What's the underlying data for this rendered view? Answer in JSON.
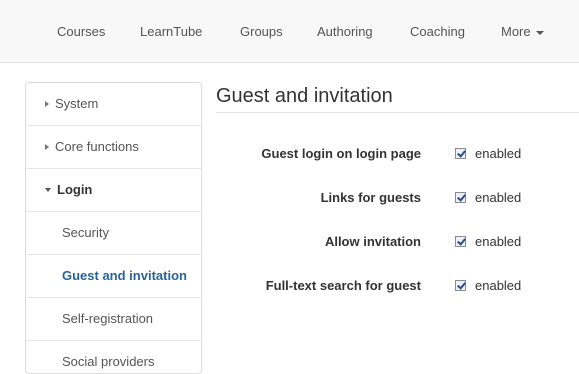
{
  "topnav": {
    "items": [
      {
        "label": "Courses"
      },
      {
        "label": "LearnTube"
      },
      {
        "label": "Groups"
      },
      {
        "label": "Authoring"
      },
      {
        "label": "Coaching"
      },
      {
        "label": "More"
      }
    ]
  },
  "sidebar": {
    "items": [
      {
        "label": "System",
        "state": "collapsed"
      },
      {
        "label": "Core functions",
        "state": "collapsed"
      },
      {
        "label": "Login",
        "state": "expanded"
      },
      {
        "label": "Security"
      },
      {
        "label": "Guest and invitation",
        "active": true
      },
      {
        "label": "Self-registration"
      },
      {
        "label": "Social providers"
      }
    ]
  },
  "main": {
    "title": "Guest and invitation",
    "rows": [
      {
        "label": "Guest login on login page",
        "checked": true,
        "value_label": "enabled"
      },
      {
        "label": "Links for guests",
        "checked": true,
        "value_label": "enabled"
      },
      {
        "label": "Allow invitation",
        "checked": true,
        "value_label": "enabled"
      },
      {
        "label": "Full-text search for guest",
        "checked": true,
        "value_label": "enabled"
      }
    ]
  },
  "colors": {
    "active_link": "#2a6496",
    "nav_background": "#f8f8f8",
    "border": "#dddddd"
  }
}
